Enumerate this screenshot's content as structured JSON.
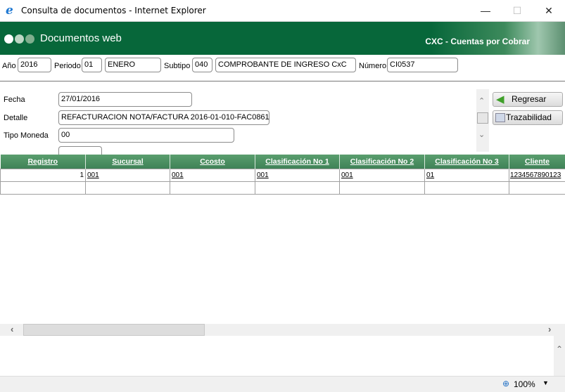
{
  "window": {
    "title": "Consulta de documentos - Internet Explorer",
    "minimize": "—",
    "maximize": "☐",
    "close": "✕"
  },
  "banner": {
    "app_name": "Documentos web",
    "module": "CXC - Cuentas por Cobrar",
    "brand_color": "#07673a"
  },
  "filters": {
    "anio_label": "Año",
    "anio": "2016",
    "periodo_label": "Periodo",
    "periodo": "01",
    "periodo_nombre": "ENERO",
    "subtipo_label": "Subtipo",
    "subtipo": "040",
    "subtipo_nombre": "COMPROBANTE DE INGRESO CxC",
    "numero_label": "Número",
    "numero": "CI0537"
  },
  "form": {
    "fecha_label": "Fecha",
    "fecha": "27/01/2016",
    "detalle_label": "Detalle",
    "detalle": "REFACTURACION NOTA/FACTURA 2016-01-010-FAC0861",
    "moneda_label": "Tipo Moneda",
    "moneda": "00"
  },
  "buttons": {
    "regresar": "Regresar",
    "trazabilidad": "Trazabilidad"
  },
  "grid": {
    "headers": [
      "Registro",
      "Sucursal",
      "Ccosto",
      "Clasificación No 1",
      "Clasificación No 2",
      "Clasificación No 3",
      "Cliente"
    ],
    "rows": [
      [
        "1",
        "001",
        "001",
        "001",
        "001",
        "01",
        "1234567890123"
      ]
    ]
  },
  "status": {
    "zoom": "100%"
  }
}
